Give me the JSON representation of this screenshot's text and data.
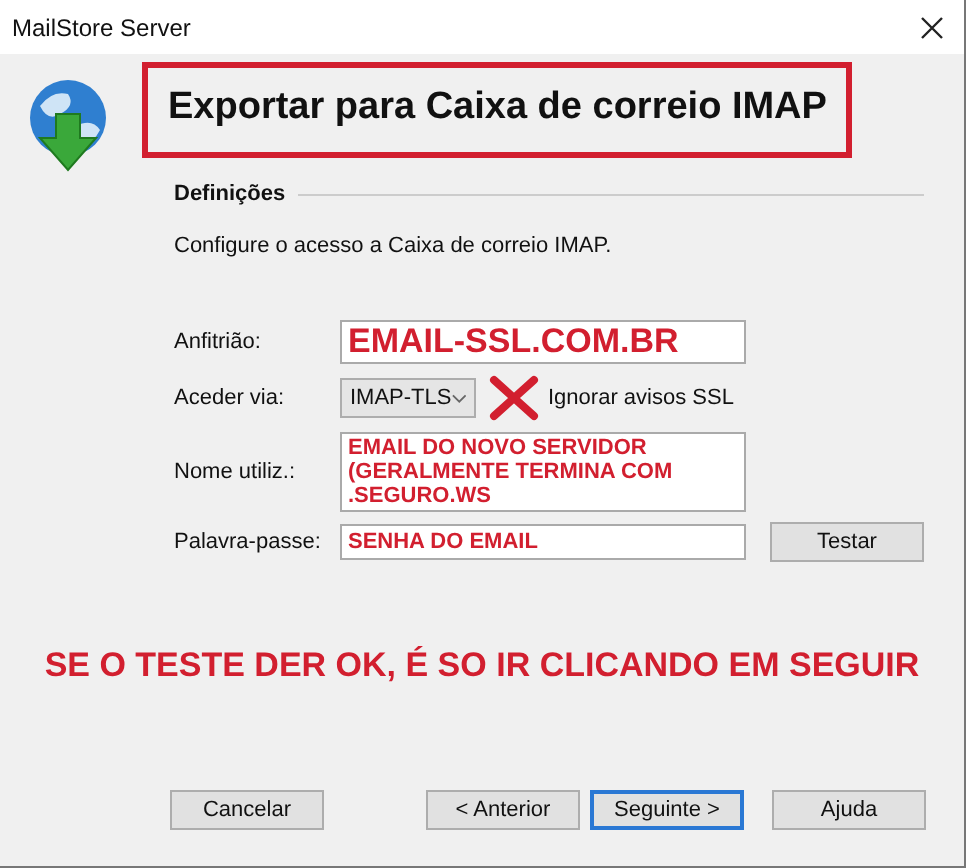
{
  "window": {
    "title": "MailStore Server"
  },
  "header": {
    "title": "Exportar para Caixa de correio IMAP"
  },
  "section": {
    "title": "Definições",
    "description": "Configure o acesso a Caixa de correio IMAP."
  },
  "fields": [
    {
      "kind": "text",
      "label": "Anfitrião:",
      "value": "EMAIL-SSL.COM.BR"
    },
    {
      "kind": "select",
      "label": "Aceder via:",
      "value": "IMAP-TLS",
      "checkbox": {
        "label": "Ignorar avisos SSL"
      }
    },
    {
      "kind": "text",
      "label": "Nome utiliz.:",
      "value": "EMAIL DO NOVO SERVIDOR (GERALMENTE TERMINA COM .SEGURO.WS"
    },
    {
      "kind": "text",
      "label": "Palavra-passe:",
      "value": "SENHA DO EMAIL",
      "button": "Testar"
    }
  ],
  "note": "SE O TESTE DER OK, É SO IR CLICANDO EM SEGUIR",
  "buttons": [
    {
      "label": "Cancelar",
      "default": false
    },
    {
      "label": "< Anterior",
      "default": false
    },
    {
      "label": "Seguinte >",
      "default": true
    },
    {
      "label": "Ajuda",
      "default": false
    }
  ]
}
